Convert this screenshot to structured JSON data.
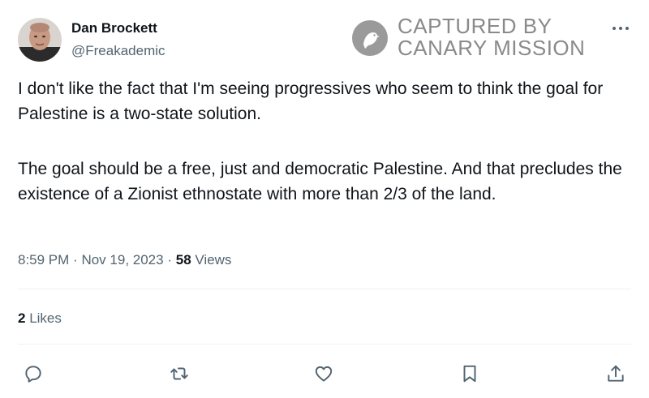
{
  "author": {
    "display_name": "Dan Brockett",
    "handle": "@Freakademic"
  },
  "watermark": {
    "line1": "CAPTURED BY",
    "line2": "CANARY MISSION"
  },
  "tweet": {
    "paragraph1": "I don't like the fact that I'm seeing progressives who seem to think the goal for Palestine is a two-state solution.",
    "paragraph2": "The goal should be a free, just and democratic Palestine. And that precludes the existence of a Zionist ethnostate with more than 2/3 of the land."
  },
  "meta": {
    "time": "8:59 PM",
    "separator": "·",
    "date": "Nov 19, 2023",
    "views_count": "58",
    "views_label": "Views"
  },
  "stats": {
    "likes_count": "2",
    "likes_label": "Likes"
  },
  "icons": {
    "more": "more-horizontal-icon",
    "reply": "reply-icon",
    "retweet": "retweet-icon",
    "like": "heart-icon",
    "bookmark": "bookmark-icon",
    "share": "share-icon"
  },
  "colors": {
    "text": "#0f1419",
    "secondary": "#536471",
    "divider": "#eff3f4",
    "watermark": "#8a8a8a"
  }
}
